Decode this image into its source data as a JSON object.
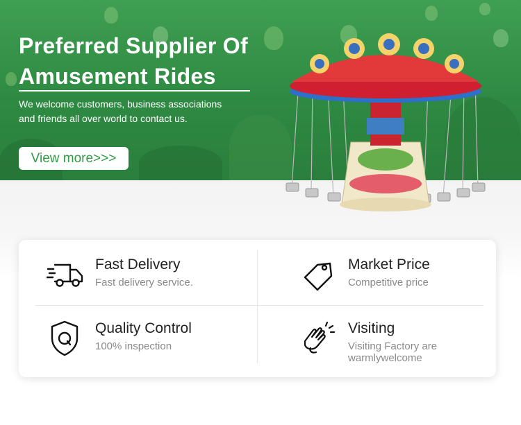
{
  "hero": {
    "title_line1": "Preferred Supplier Of",
    "title_line2": "Amusement Rides",
    "subtitle_line1": "We welcome customers, business associations",
    "subtitle_line2": "and friends all over world to contact us.",
    "button_label": "View more>>>"
  },
  "features": [
    {
      "title": "Fast Delivery",
      "desc_line1": "Fast delivery service.",
      "desc_line2": "",
      "icon": "truck-icon"
    },
    {
      "title": "Market Price",
      "desc_line1": "Competitive price",
      "desc_line2": "",
      "icon": "price-tag-icon"
    },
    {
      "title": "Quality Control",
      "desc_line1": "100% inspection",
      "desc_line2": "",
      "icon": "shield-q-icon"
    },
    {
      "title": "Visiting",
      "desc_line1": "Visiting Factory are",
      "desc_line2": "warmlywelcome",
      "icon": "clapping-hands-icon"
    }
  ],
  "colors": {
    "brand_green": "#2f9b43",
    "text_dark": "#222222",
    "text_muted": "#8a8a8a"
  }
}
